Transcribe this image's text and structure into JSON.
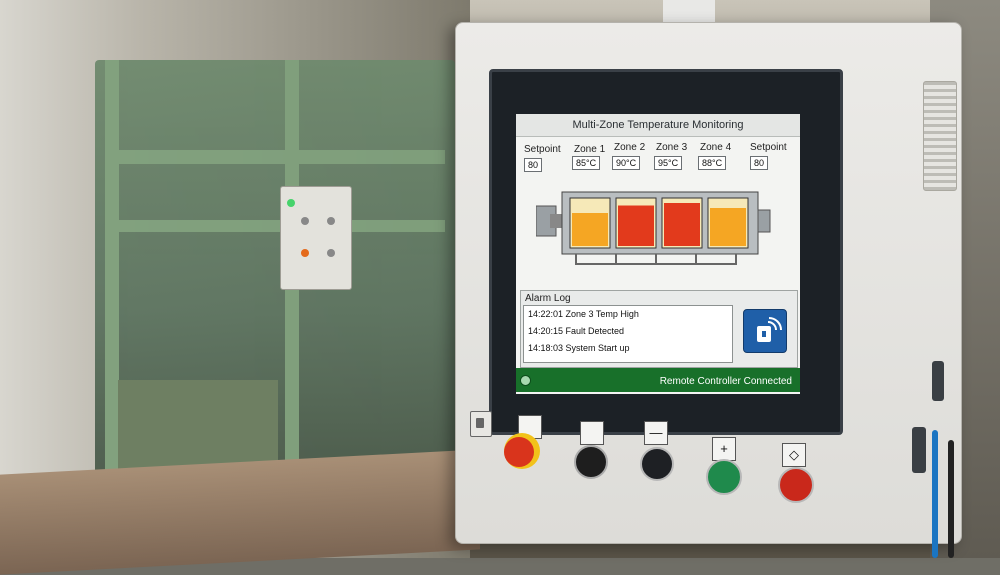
{
  "hmi": {
    "title": "Multi-Zone Temperature Monitoring",
    "setpoint_left": {
      "label": "Setpoint",
      "value": "80"
    },
    "setpoint_right": {
      "label": "Setpoint",
      "value": "80"
    },
    "zones": [
      {
        "label": "Zone 1",
        "value": "85°C",
        "fill": 0.7
      },
      {
        "label": "Zone 2",
        "value": "90°C",
        "fill": 0.85
      },
      {
        "label": "Zone 3",
        "value": "95°C",
        "fill": 0.9
      },
      {
        "label": "Zone 4",
        "value": "88°C",
        "fill": 0.8
      }
    ],
    "alarm_log": {
      "title": "Alarm Log",
      "entries": [
        "14:22:01 Zone 3 Temp High",
        "14:20:15 Fault Detected",
        "14:18:03 System Start up"
      ]
    },
    "status": "Remote Controller Connected"
  },
  "panel_buttons": [
    "—",
    "+",
    "◇"
  ],
  "colors": {
    "zone_hot": "#e23a1c",
    "zone_warm": "#f5a623",
    "status_green": "#18702a",
    "remote_blue": "#1f5fa8",
    "estop_red": "#d9341c",
    "estop_yellow": "#f2c21a",
    "button_green": "#1f8a4c",
    "button_red": "#c9281b"
  }
}
